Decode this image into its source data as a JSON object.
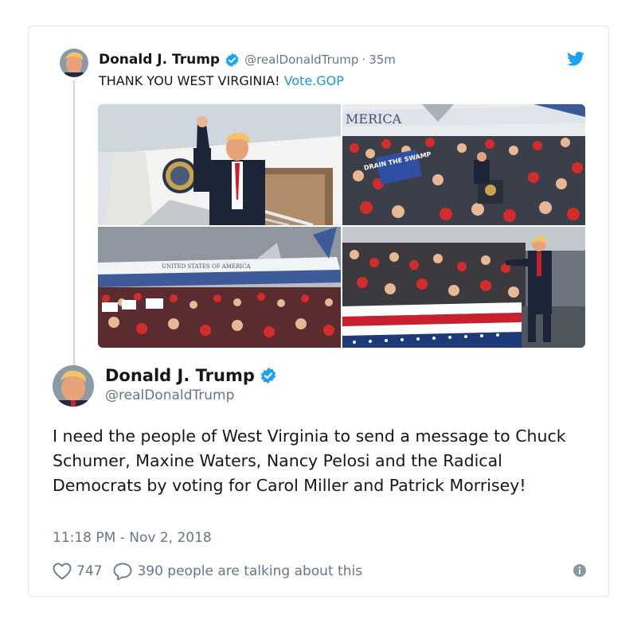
{
  "quoted_tweet": {
    "display_name": "Donald J. Trump",
    "handle": "@realDonaldTrump",
    "separator": "·",
    "relative_time": "35m",
    "text": "THANK YOU WEST VIRGINIA! ",
    "link_text": "Vote.GOP",
    "media": [
      {
        "name": "photo-airforce-one-stairs",
        "overlay_text": ""
      },
      {
        "name": "photo-rally-crowd",
        "overlay_text": "MERICA",
        "sign_text": "DRAIN THE SWAMP"
      },
      {
        "name": "photo-airplane-crowd",
        "overlay_text": "UNITED STATES OF AMERICA"
      },
      {
        "name": "photo-stage-crowd",
        "overlay_text": ""
      }
    ]
  },
  "main_tweet": {
    "display_name": "Donald J. Trump",
    "handle": "@realDonaldTrump",
    "text": "I need the people of West Virginia to send a message to Chuck Schumer, Maxine Waters, Nancy Pelosi and the Radical Democrats by voting for Carol Miller and Patrick Morrisey!",
    "timestamp": "11:18 PM - Nov 2, 2018",
    "likes": "747",
    "replies": "390 people are talking about this"
  },
  "icons": {
    "verified": "verified-badge-icon",
    "brand": "twitter-bird-icon",
    "like": "heart-icon",
    "reply": "speech-bubble-icon",
    "info": "info-icon"
  },
  "colors": {
    "accent": "#1da1f2",
    "link": "#1b95e0",
    "secondary_text": "#657786",
    "border": "#e1e8ed"
  }
}
